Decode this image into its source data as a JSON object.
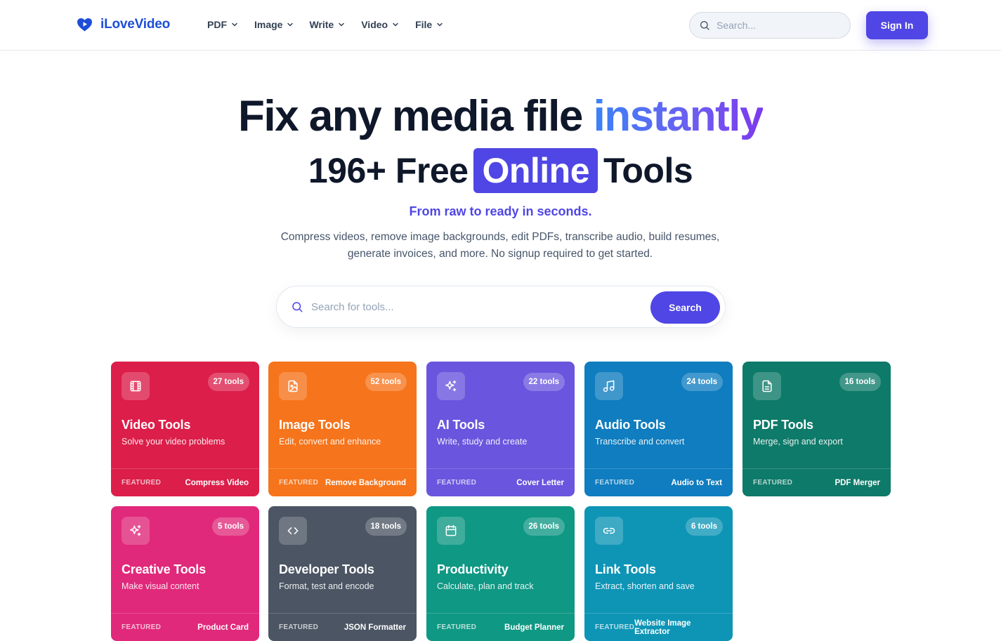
{
  "brand": {
    "name": "iLoveVideo",
    "color": "#1d4ed8"
  },
  "nav": {
    "items": [
      {
        "label": "PDF"
      },
      {
        "label": "Image"
      },
      {
        "label": "Write"
      },
      {
        "label": "Video"
      },
      {
        "label": "File"
      }
    ],
    "search_placeholder": "Search...",
    "signin_label": "Sign In"
  },
  "hero": {
    "headline_prefix": "Fix any media file",
    "headline_accent": "instantly",
    "subheadline_prefix": "196+ Free",
    "subheadline_highlight": "Online",
    "subheadline_suffix": "Tools",
    "tagline": "From raw to ready in seconds.",
    "description_line1": "Compress videos, remove image backgrounds, edit PDFs, transcribe audio, build resumes,",
    "description_line2": "generate invoices, and more. No signup required to get started."
  },
  "tool_search": {
    "placeholder": "Search for tools...",
    "button_label": "Search"
  },
  "categories": [
    {
      "title": "Video Tools",
      "subtitle": "Solve your video problems",
      "count": "27 tools",
      "featured_label": "FEATURED",
      "featured_tool": "Compress Video",
      "color": "#dc1e4a",
      "icon": "film-icon"
    },
    {
      "title": "Image Tools",
      "subtitle": "Edit, convert and enhance",
      "count": "52 tools",
      "featured_label": "FEATURED",
      "featured_tool": "Remove Background",
      "color": "#f6741b",
      "icon": "image-file-icon"
    },
    {
      "title": "AI Tools",
      "subtitle": "Write, study and create",
      "count": "22 tools",
      "featured_label": "FEATURED",
      "featured_tool": "Cover Letter",
      "color": "#6a55de",
      "icon": "sparkles-icon"
    },
    {
      "title": "Audio Tools",
      "subtitle": "Transcribe and convert",
      "count": "24 tools",
      "featured_label": "FEATURED",
      "featured_tool": "Audio to Text",
      "color": "#0f7dbf",
      "icon": "music-note-icon"
    },
    {
      "title": "PDF Tools",
      "subtitle": "Merge, sign and export",
      "count": "16 tools",
      "featured_label": "FEATURED",
      "featured_tool": "PDF Merger",
      "color": "#0e7a69",
      "icon": "document-icon"
    },
    {
      "title": "Creative Tools",
      "subtitle": "Make visual content",
      "count": "5 tools",
      "featured_label": "FEATURED",
      "featured_tool": "Product Card",
      "color": "#e0297a",
      "icon": "sparkles-icon"
    },
    {
      "title": "Developer Tools",
      "subtitle": "Format, test and encode",
      "count": "18 tools",
      "featured_label": "FEATURED",
      "featured_tool": "JSON Formatter",
      "color": "#4b5563",
      "icon": "code-icon"
    },
    {
      "title": "Productivity",
      "subtitle": "Calculate, plan and track",
      "count": "26 tools",
      "featured_label": "FEATURED",
      "featured_tool": "Budget Planner",
      "color": "#0f9884",
      "icon": "calendar-icon"
    },
    {
      "title": "Link Tools",
      "subtitle": "Extract, shorten and save",
      "count": "6 tools",
      "featured_label": "FEATURED",
      "featured_tool": "Website Image Extractor",
      "color": "#0e95b6",
      "icon": "link-icon"
    }
  ]
}
